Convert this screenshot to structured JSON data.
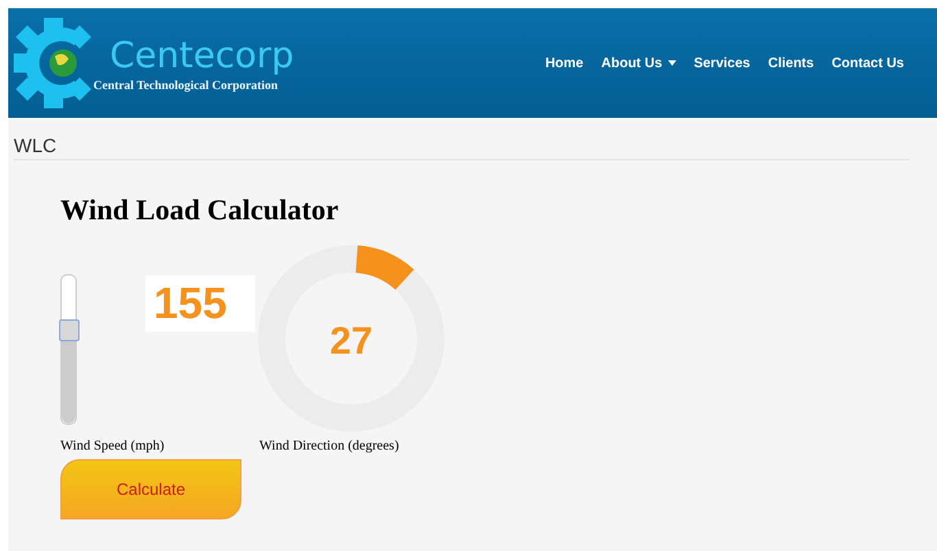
{
  "brand": {
    "name": "Centecorp",
    "tagline": "Central Technological Corporation"
  },
  "nav": [
    {
      "label": "Home",
      "dropdown": false
    },
    {
      "label": "About Us",
      "dropdown": true
    },
    {
      "label": "Services",
      "dropdown": false
    },
    {
      "label": "Clients",
      "dropdown": false
    },
    {
      "label": "Contact Us",
      "dropdown": false
    }
  ],
  "breadcrumb": "WLC",
  "title": "Wind Load Calculator",
  "speed": {
    "value": "155",
    "level": 0.64,
    "label": "Wind Speed (mph)"
  },
  "direction": {
    "value": "27",
    "label": "Wind Direction (degrees)"
  },
  "button": "Calculate"
}
